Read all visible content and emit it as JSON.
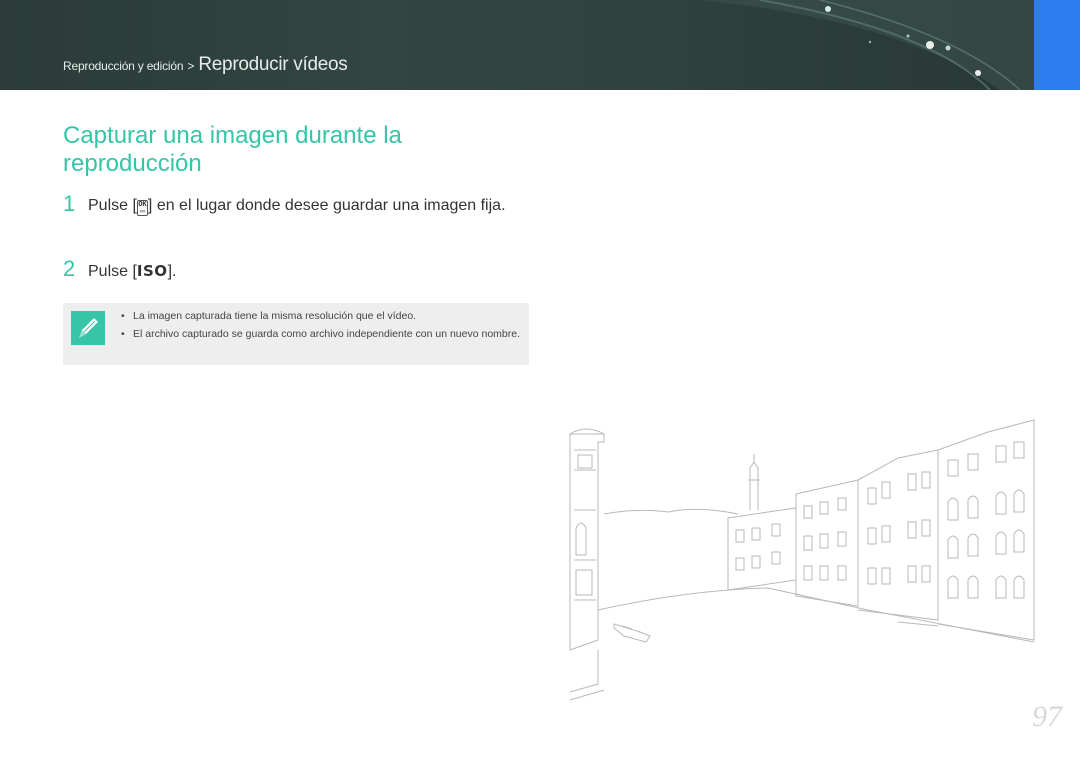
{
  "header": {
    "breadcrumb_section": "Reproducción y edición",
    "breadcrumb_separator": ">",
    "breadcrumb_page": "Reproducir vídeos",
    "accent_color": "#2d7cf0",
    "banner_color": "#2f423f"
  },
  "section": {
    "title": "Capturar una imagen durante la reproducción",
    "title_color": "#36c5a6"
  },
  "steps": [
    {
      "number": "1",
      "before": "Pulse [",
      "key_icon": "ok-button-icon",
      "after": "] en el lugar donde desee guardar una imagen fija."
    },
    {
      "number": "2",
      "before": "Pulse [",
      "key_label": "ISO",
      "after": "]."
    }
  ],
  "note": {
    "icon": "pen-icon",
    "items": [
      "La imagen capturada tiene la misma resolución que el vídeo.",
      "El archivo capturado se guarda como archivo independiente con un nuevo nombre."
    ]
  },
  "illustration": "city-canal-sketch",
  "page_number": "97"
}
